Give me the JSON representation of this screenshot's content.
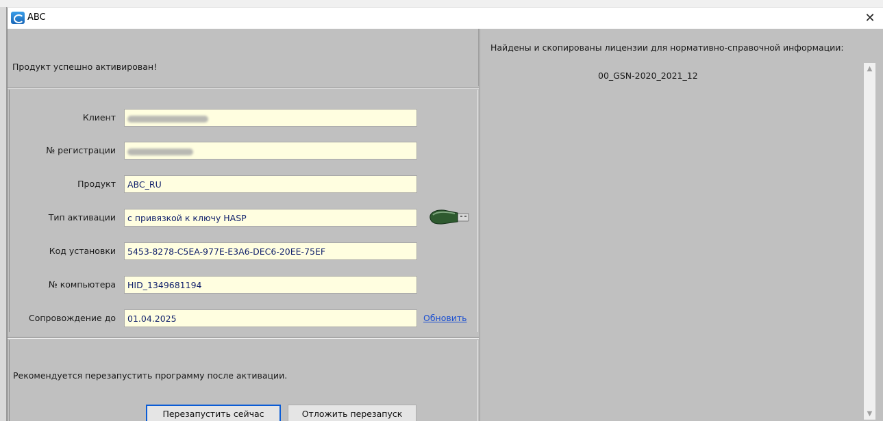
{
  "window": {
    "title": "ABC",
    "close": "✕"
  },
  "left": {
    "success_message": "Продукт успешно активирован!",
    "fields": [
      {
        "label": "Клиент",
        "value": ""
      },
      {
        "label": "№ регистрации",
        "value": ""
      },
      {
        "label": "Продукт",
        "value": "ABC_RU"
      },
      {
        "label": "Тип активации",
        "value": "с привязкой к ключу HASP"
      },
      {
        "label": "Код установки",
        "value": "5453-8278-C5EA-977E-E3A6-DEC6-20EE-75EF"
      },
      {
        "label": "№ компьютера",
        "value": "HID_1349681194"
      },
      {
        "label": "Сопровождение до",
        "value": "01.04.2025"
      }
    ],
    "refresh_link": "Обновить",
    "restart_message": "Рекомендуется перезапустить программу после активации.",
    "buttons": {
      "restart_now": "Перезапустить сейчас",
      "postpone": "Отложить перезапуск"
    }
  },
  "right": {
    "header": "Найдены и скопированы лицензии для нормативно-справочной информации:",
    "licenses": [
      "00_GSN-2020_2021_12"
    ]
  },
  "icons": {
    "app": "app-logo-icon",
    "usb_key": "usb-hasp-key-icon",
    "close": "close-icon"
  },
  "colors": {
    "field_bg": "#fffee0",
    "field_text": "#0f1f6a",
    "link": "#1b4fd1",
    "primary_border": "#0a5cd6"
  }
}
